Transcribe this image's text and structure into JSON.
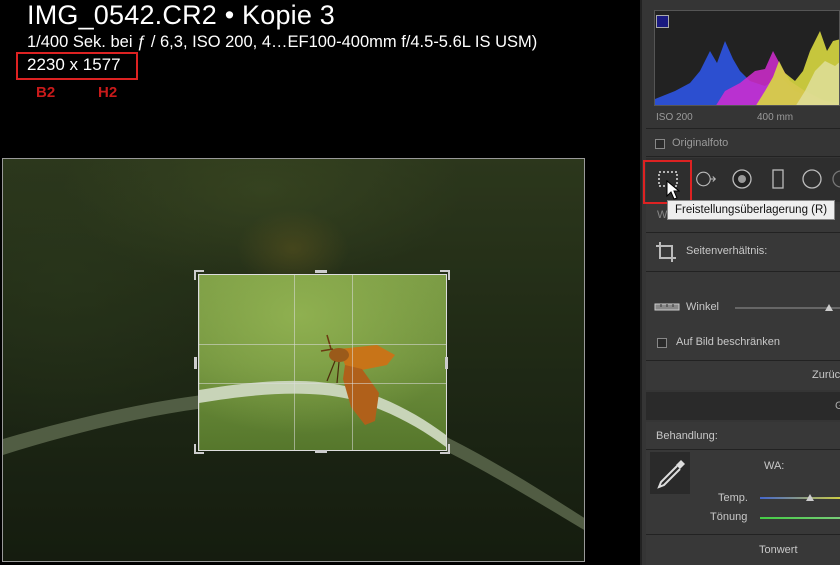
{
  "header": {
    "title": "IMG_0542.CR2 • Kopie 3",
    "meta": "1/400 Sek. bei ƒ / 6,3, ISO 200, 4…EF100-400mm f/4.5-5.6L IS USM)",
    "dimensions": "2230 x 1577",
    "annotation_b": "B2",
    "annotation_h": "H2"
  },
  "histogram": {
    "iso": "ISO 200",
    "focal": "400 mm",
    "original_label": "Originalfoto"
  },
  "tools": {
    "tooltip": "Freistellungsüberlagerung (R)",
    "items": [
      "crop-overlay-icon",
      "spot-removal-icon",
      "red-eye-icon",
      "graduated-filter-icon",
      "radial-filter-icon"
    ]
  },
  "crop_panel": {
    "partial_label": "W",
    "aspect_label": "Seitenverhältnis:",
    "angle_label": "Winkel",
    "constrain_label": "Auf Bild beschränken",
    "reset_label": "Zurüc"
  },
  "section_partial": "G",
  "basic": {
    "treatment_label": "Behandlung:",
    "wb_label": "WA:",
    "temp_label": "Temp.",
    "tint_label": "Tönung",
    "tone_label": "Tonwert"
  },
  "colors": {
    "annotation_red": "#d22222",
    "panel_bg": "#353535"
  }
}
